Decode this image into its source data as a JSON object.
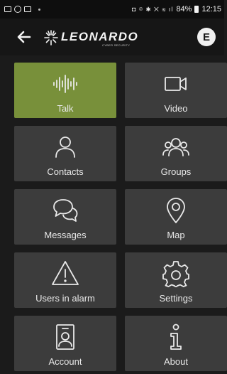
{
  "status_bar": {
    "battery": "84%",
    "time": "12:15"
  },
  "header": {
    "logo_text": "LEONARDO",
    "logo_subtext": "CYBER SECURITY",
    "e_button": "E"
  },
  "tiles": [
    {
      "label": "Talk",
      "icon": "waveform-icon",
      "active": true
    },
    {
      "label": "Video",
      "icon": "video-camera-icon",
      "active": false
    },
    {
      "label": "Contacts",
      "icon": "person-icon",
      "active": false
    },
    {
      "label": "Groups",
      "icon": "people-group-icon",
      "active": false
    },
    {
      "label": "Messages",
      "icon": "chat-bubbles-icon",
      "active": false
    },
    {
      "label": "Map",
      "icon": "map-pin-icon",
      "active": false
    },
    {
      "label": "Users in alarm",
      "icon": "warning-triangle-icon",
      "active": false
    },
    {
      "label": "Settings",
      "icon": "gear-icon",
      "active": false
    },
    {
      "label": "Account",
      "icon": "id-badge-icon",
      "active": false
    },
    {
      "label": "About",
      "icon": "info-icon",
      "active": false
    }
  ],
  "colors": {
    "active_tile": "#78903a",
    "tile": "#3c3c3c",
    "background": "#1b1b1b"
  }
}
